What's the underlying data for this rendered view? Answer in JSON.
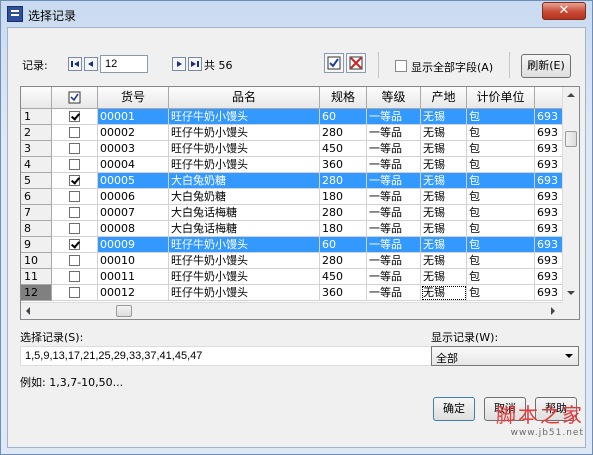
{
  "window": {
    "title": "选择记录",
    "close_symbol": "✕"
  },
  "toolbar": {
    "record_label": "记录:",
    "current_record": "12",
    "total_text": "共 56",
    "show_all_fields_label": "显示全部字段(A)",
    "refresh_label": "刷新(E)"
  },
  "grid": {
    "columns": [
      "货号",
      "品名",
      "规格",
      "等级",
      "产地",
      "计价单位"
    ],
    "rows": [
      {
        "num": "1",
        "checked": true,
        "selected": true,
        "code": "00001",
        "name": "旺仔牛奶小馒头",
        "spec": "60",
        "grade": "一等品",
        "origin": "无锡",
        "unit": "包",
        "extra": "693"
      },
      {
        "num": "2",
        "checked": false,
        "selected": false,
        "code": "00002",
        "name": "旺仔牛奶小馒头",
        "spec": "280",
        "grade": "一等品",
        "origin": "无锡",
        "unit": "包",
        "extra": "693"
      },
      {
        "num": "3",
        "checked": false,
        "selected": false,
        "code": "00003",
        "name": "旺仔牛奶小馒头",
        "spec": "450",
        "grade": "一等品",
        "origin": "无锡",
        "unit": "包",
        "extra": "693"
      },
      {
        "num": "4",
        "checked": false,
        "selected": false,
        "code": "00004",
        "name": "旺仔牛奶小馒头",
        "spec": "360",
        "grade": "一等品",
        "origin": "无锡",
        "unit": "包",
        "extra": "693"
      },
      {
        "num": "5",
        "checked": true,
        "selected": true,
        "code": "00005",
        "name": "大白兔奶糖",
        "spec": "280",
        "grade": "一等品",
        "origin": "无锡",
        "unit": "包",
        "extra": "693"
      },
      {
        "num": "6",
        "checked": false,
        "selected": false,
        "code": "00006",
        "name": "大白兔奶糖",
        "spec": "180",
        "grade": "一等品",
        "origin": "无锡",
        "unit": "包",
        "extra": "693"
      },
      {
        "num": "7",
        "checked": false,
        "selected": false,
        "code": "00007",
        "name": "大白兔话梅糖",
        "spec": "280",
        "grade": "一等品",
        "origin": "无锡",
        "unit": "包",
        "extra": "693"
      },
      {
        "num": "8",
        "checked": false,
        "selected": false,
        "code": "00008",
        "name": "大白兔话梅糖",
        "spec": "180",
        "grade": "一等品",
        "origin": "无锡",
        "unit": "包",
        "extra": "693"
      },
      {
        "num": "9",
        "checked": true,
        "selected": true,
        "code": "00009",
        "name": "旺仔牛奶小馒头",
        "spec": "60",
        "grade": "一等品",
        "origin": "无锡",
        "unit": "包",
        "extra": "693"
      },
      {
        "num": "10",
        "checked": false,
        "selected": false,
        "code": "00010",
        "name": "旺仔牛奶小馒头",
        "spec": "280",
        "grade": "一等品",
        "origin": "无锡",
        "unit": "包",
        "extra": "693"
      },
      {
        "num": "11",
        "checked": false,
        "selected": false,
        "code": "00011",
        "name": "旺仔牛奶小馒头",
        "spec": "450",
        "grade": "一等品",
        "origin": "无锡",
        "unit": "包",
        "extra": "693"
      },
      {
        "num": "12",
        "checked": false,
        "selected": false,
        "current": true,
        "code": "00012",
        "name": "旺仔牛奶小馒头",
        "spec": "360",
        "grade": "一等品",
        "origin": "无锡",
        "unit": "包",
        "extra": "693"
      }
    ]
  },
  "selection": {
    "label": "选择记录(S):",
    "value": "1,5,9,13,17,21,25,29,33,37,41,45,47",
    "example": "例如: 1,3,7-10,50..."
  },
  "display": {
    "label": "显示记录(W):",
    "selected": "全部"
  },
  "buttons": {
    "ok": "确定",
    "cancel": "取消",
    "help": "帮助"
  },
  "watermark": {
    "line1": "脚本之家",
    "line2": "www.jb51.net"
  },
  "colors": {
    "selection": "#3399ff",
    "accent": "#d9442f"
  }
}
